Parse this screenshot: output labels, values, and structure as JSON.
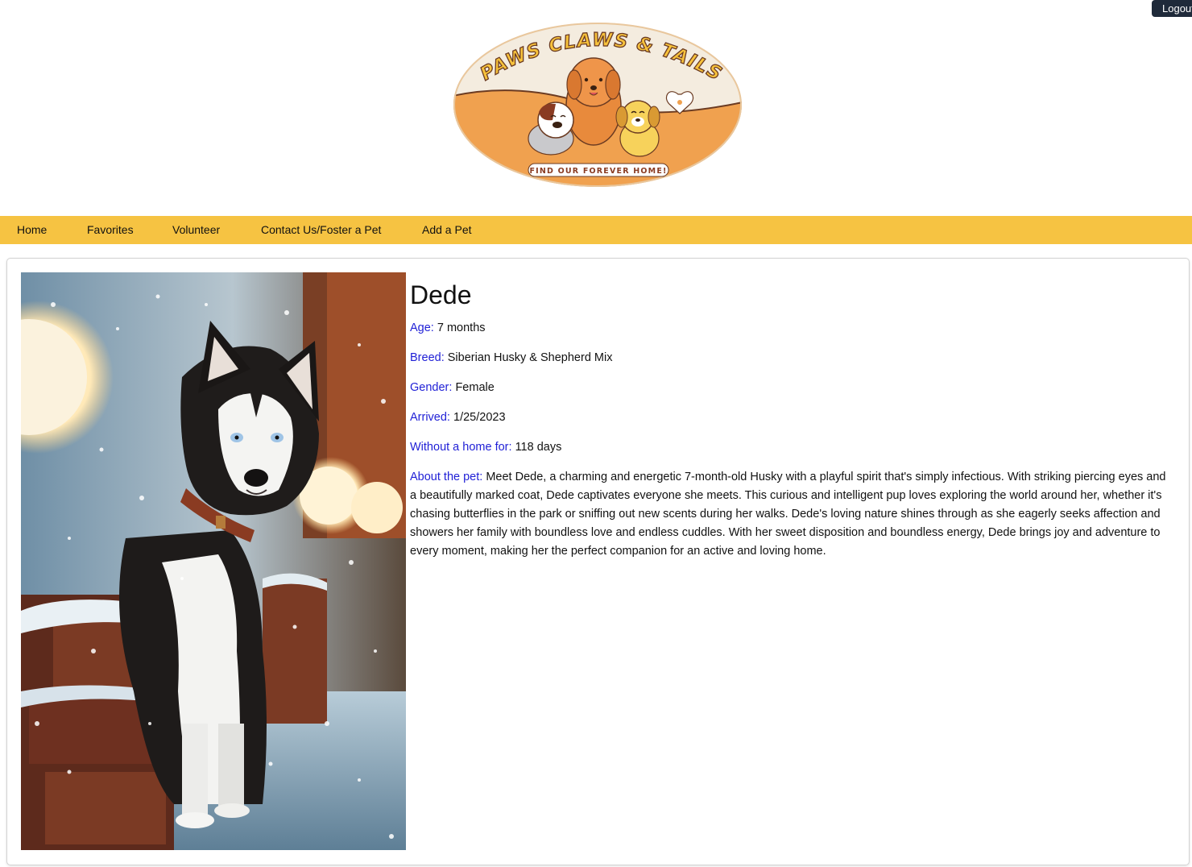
{
  "header": {
    "logout_label": "Logout",
    "logo": {
      "top_text": "PAWS CLAWS & TAILS",
      "tagline": "FIND OUR FOREVER HOME!"
    }
  },
  "nav": {
    "items": [
      {
        "label": "Home"
      },
      {
        "label": "Favorites"
      },
      {
        "label": "Volunteer"
      },
      {
        "label": "Contact Us/Foster a Pet"
      },
      {
        "label": "Add a Pet"
      }
    ]
  },
  "pet": {
    "name": "Dede",
    "age_label": "Age:",
    "age": "7 months",
    "breed_label": "Breed:",
    "breed": "Siberian Husky & Shepherd Mix",
    "gender_label": "Gender:",
    "gender": "Female",
    "arrived_label": "Arrived:",
    "arrived": "1/25/2023",
    "without_label": "Without a home for:",
    "without": "118 days",
    "about_label": "About the pet:",
    "about": "Meet Dede, a charming and energetic 7-month-old Husky with a playful spirit that's simply infectious. With striking piercing eyes and a beautifully marked coat, Dede captivates everyone she meets. This curious and intelligent pup loves exploring the world around her, whether it's chasing butterflies in the park or sniffing out new scents during her walks. Dede's loving nature shines through as she eagerly seeks affection and showers her family with boundless love and endless cuddles. With her sweet disposition and boundless energy, Dede brings joy and adventure to every moment, making her the perfect companion for an active and loving home."
  },
  "colors": {
    "nav_bg": "#f6c342",
    "label_blue": "#1f1fd6",
    "logout_bg": "#1f2a3a",
    "logo_orange": "#f0a14f",
    "logo_cream": "#f4ecdf"
  }
}
